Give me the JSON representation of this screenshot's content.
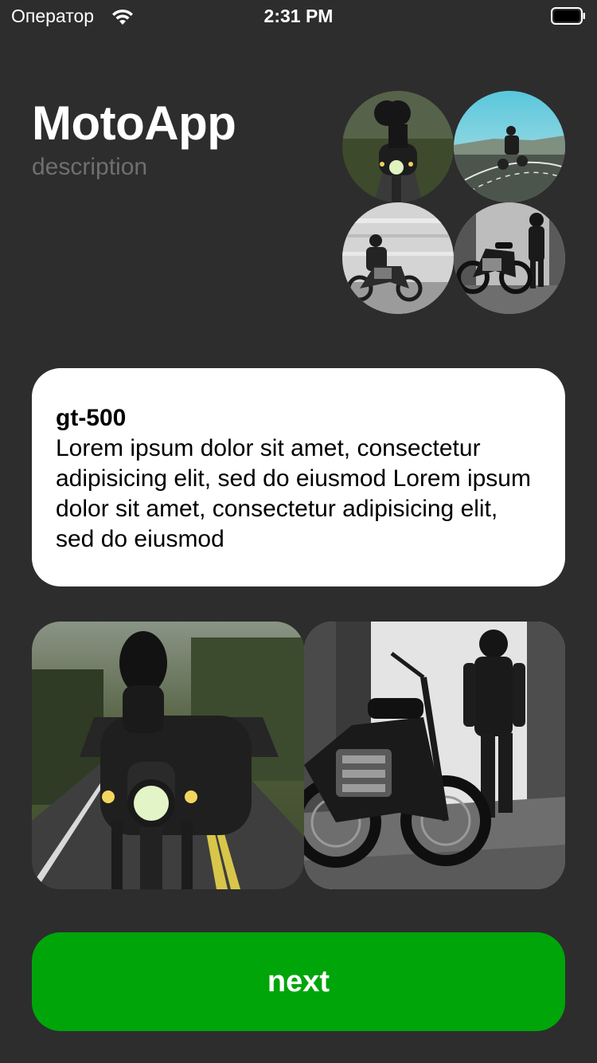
{
  "status_bar": {
    "carrier": "Оператор",
    "time": "2:31 PM"
  },
  "header": {
    "title": "MotoApp",
    "subtitle": "description"
  },
  "thumbnails": [
    {
      "name": "rider-road-front-thumbnail"
    },
    {
      "name": "rider-coast-road-thumbnail"
    },
    {
      "name": "rider-side-motion-thumbnail"
    },
    {
      "name": "bike-and-walker-thumbnail"
    }
  ],
  "card": {
    "title": "gt-500",
    "text": "Lorem ipsum dolor sit amet, consectetur adipisicing elit, sed do eiusmod Lorem ipsum dolor sit amet, consectetur adipisicing elit, sed do eiusmod"
  },
  "photos": [
    {
      "name": "rider-road-front-photo"
    },
    {
      "name": "bike-and-walker-photo"
    }
  ],
  "next_button": {
    "label": "next"
  },
  "colors": {
    "background": "#2d2d2d",
    "accent": "#00a50a",
    "card": "#ffffff",
    "subtitle": "#6f6f6f"
  }
}
